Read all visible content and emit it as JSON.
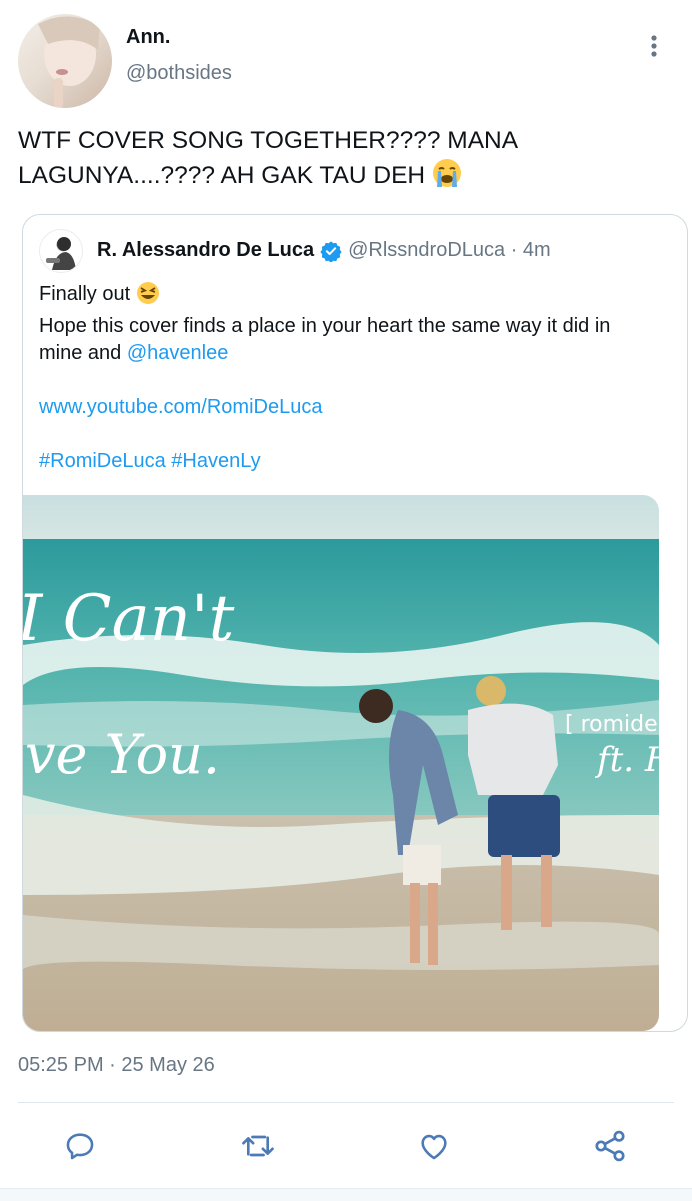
{
  "author": {
    "display_name": "Ann.",
    "handle": "@bothsides"
  },
  "tweet": {
    "text": "WTF COVER SONG TOGETHER???? MANA LAGUNYA....???? AH GAK TAU DEH"
  },
  "quoted": {
    "display_name": "R. Alessandro De Luca",
    "handle_time": "@RlssndroDLuca · 4m",
    "line1": "Finally out",
    "line2": "Hope this cover finds a place in your heart the same way it did in mine and",
    "mention": "@havenlee",
    "url": "www.youtube.com/RomiDeLuca",
    "hashtags": "#RomiDeLuca #HavenLy",
    "media": {
      "title_line1": "I Can't",
      "title_line2": "ve You.",
      "tag_line1": "[ romide",
      "tag_line2": "ft. H"
    }
  },
  "meta": {
    "timestamp": "05:25 PM · 25 May 26"
  },
  "icons": [
    "more-vertical-icon",
    "verified-icon",
    "reply-icon",
    "retweet-icon",
    "like-icon",
    "share-icon"
  ],
  "colors": {
    "link": "#1d9bf0",
    "secondary_text": "#687684",
    "icon": "#4b7ab6"
  }
}
